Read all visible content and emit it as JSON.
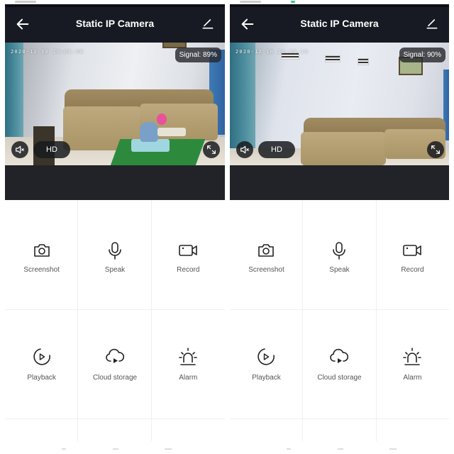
{
  "screens": [
    {
      "header": {
        "title": "Static IP Camera",
        "back_icon": "arrow-left-icon",
        "edit_icon": "pencil-icon"
      },
      "video": {
        "timestamp": "2020-12-18 10:01:00",
        "signal_label": "Signal: 89%",
        "signal_percent": 89,
        "quality_label": "HD",
        "mute_icon": "speaker-muted-icon",
        "fullscreen_icon": "fullscreen-icon"
      },
      "actions": [
        {
          "label": "Screenshot",
          "icon": "camera-icon"
        },
        {
          "label": "Speak",
          "icon": "microphone-icon"
        },
        {
          "label": "Record",
          "icon": "video-camera-icon"
        },
        {
          "label": "Playback",
          "icon": "playback-icon"
        },
        {
          "label": "Cloud storage",
          "icon": "cloud-play-icon"
        },
        {
          "label": "Alarm",
          "icon": "alarm-siren-icon"
        }
      ]
    },
    {
      "header": {
        "title": "Static IP Camera",
        "back_icon": "arrow-left-icon",
        "edit_icon": "pencil-icon"
      },
      "video": {
        "timestamp": "2020-12-18 22:56:19",
        "signal_label": "Signal: 90%",
        "signal_percent": 90,
        "quality_label": "HD",
        "mute_icon": "speaker-muted-icon",
        "fullscreen_icon": "fullscreen-icon"
      },
      "actions": [
        {
          "label": "Screenshot",
          "icon": "camera-icon"
        },
        {
          "label": "Speak",
          "icon": "microphone-icon"
        },
        {
          "label": "Record",
          "icon": "video-camera-icon"
        },
        {
          "label": "Playback",
          "icon": "playback-icon"
        },
        {
          "label": "Cloud storage",
          "icon": "cloud-play-icon"
        },
        {
          "label": "Alarm",
          "icon": "alarm-siren-icon"
        }
      ]
    }
  ]
}
